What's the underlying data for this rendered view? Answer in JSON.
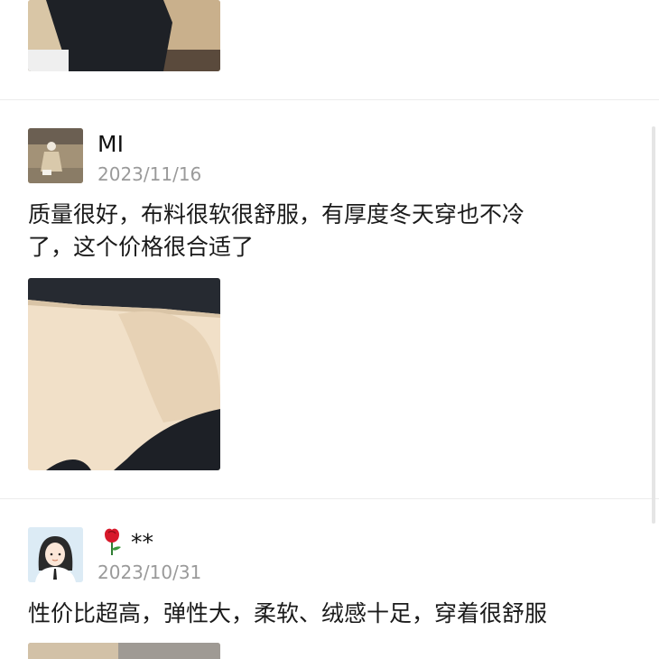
{
  "reviews": [
    {
      "image_alt": "photo of black trousers"
    },
    {
      "username": "MI",
      "date": "2023/11/16",
      "text_line1": "质量很好，布料很软很舒服，有厚度冬天穿也不冷",
      "text_line2": "了，这个价格很合适了",
      "image_alt": "photo of fleece-lined black trousers"
    },
    {
      "username_icon": "rose-icon",
      "username": "**",
      "date": "2023/10/31",
      "text_line1": "性价比超高，弹性大，柔软、绒感十足，穿着很舒服",
      "image_alt": "photo of trousers"
    }
  ],
  "colors": {
    "date": "#9a9a9a",
    "divider": "#ececec",
    "fleece": "#f1e0c8",
    "fabric": "#1c1f24"
  }
}
